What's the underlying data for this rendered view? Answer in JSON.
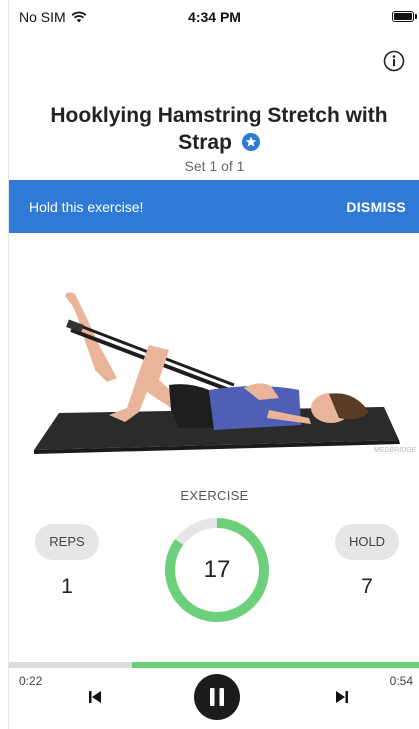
{
  "status_bar": {
    "carrier": "No SIM",
    "time": "4:34 PM",
    "icons": [
      "wifi-icon",
      "battery-icon"
    ]
  },
  "header": {
    "title": "Hooklying Hamstring Stretch with Strap",
    "badge_icon": "star-badge-icon",
    "set_label": "Set 1 of 1",
    "info_icon": "info-icon"
  },
  "banner": {
    "message": "Hold this exercise!",
    "dismiss_label": "DISMISS",
    "color": "#2f7ad6"
  },
  "illustration": {
    "watermark": "MEDBRIDGE"
  },
  "exercise": {
    "label": "EXERCISE",
    "counter": "17",
    "ring_fraction": 0.85,
    "ring_color": "#6ccf7a",
    "reps_label": "REPS",
    "reps_value": "1",
    "hold_label": "HOLD",
    "hold_value": "7"
  },
  "player": {
    "elapsed": "0:22",
    "total": "0:54",
    "played_fraction": 0.3,
    "controls": [
      "skip-previous-icon",
      "pause-icon",
      "skip-next-icon"
    ]
  }
}
